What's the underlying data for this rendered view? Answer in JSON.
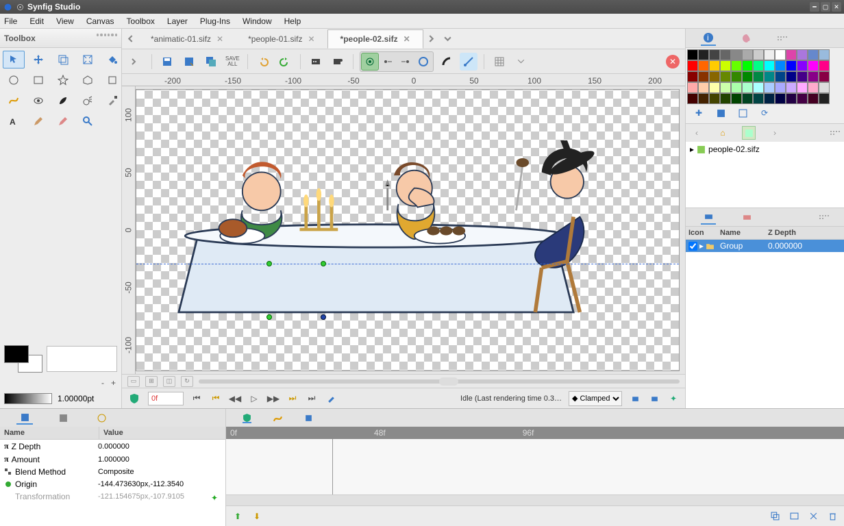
{
  "window": {
    "title": "Synfig Studio"
  },
  "menu": [
    "File",
    "Edit",
    "View",
    "Canvas",
    "Toolbox",
    "Layer",
    "Plug-Ins",
    "Window",
    "Help"
  ],
  "toolbox": {
    "title": "Toolbox",
    "size_minus": "-",
    "size_plus": "+",
    "point_size": "1.00000pt",
    "tools": [
      "arrow",
      "transform",
      "bezier",
      "warp",
      "bucket",
      "circle",
      "rect",
      "star",
      "polygon",
      "crop",
      "curve",
      "eye",
      "brush",
      "spray",
      "picker",
      "text",
      "pencil",
      "eraser",
      "zoom"
    ]
  },
  "tabs": [
    {
      "label": "*animatic-01.sifz",
      "active": false
    },
    {
      "label": "*people-01.sifz",
      "active": false
    },
    {
      "label": "*people-02.sifz",
      "active": true
    }
  ],
  "canvas_toolbar": {
    "save_all_label": "SAVE\nALL"
  },
  "ruler_h": [
    "-200",
    "-150",
    "-100",
    "-50",
    "0",
    "50",
    "100",
    "150",
    "200"
  ],
  "ruler_v": [
    "100",
    "50",
    "0",
    "-50",
    "-100"
  ],
  "playback": {
    "time_value": "0f",
    "status_text": "Idle (Last rendering time 0.3…",
    "interpolation": "Clamped"
  },
  "params_panel": {
    "columns": {
      "name": "Name",
      "value": "Value"
    },
    "rows": [
      {
        "icon": "pi",
        "name": "Z Depth",
        "value": "0.000000"
      },
      {
        "icon": "pi",
        "name": "Amount",
        "value": "1.000000"
      },
      {
        "icon": "blend",
        "name": "Blend Method",
        "value": "Composite"
      },
      {
        "icon": "origin",
        "name": "Origin",
        "value": "-144.473630px,-112.3540"
      },
      {
        "icon": "none",
        "name": "Transformation",
        "value": "-121.154675px,-107.9105"
      }
    ]
  },
  "timeline": {
    "marks": [
      "0f",
      "48f",
      "96f"
    ]
  },
  "palette_colors": [
    [
      "#000",
      "#222",
      "#444",
      "#666",
      "#888",
      "#aaa",
      "#ccc",
      "#eee",
      "#fff",
      "#d4a",
      "#a7d",
      "#68c",
      "#9bd"
    ],
    [
      "#f00",
      "#f60",
      "#fc0",
      "#cf0",
      "#6f0",
      "#0f0",
      "#0f8",
      "#0ff",
      "#08f",
      "#00f",
      "#80f",
      "#f0f",
      "#f08"
    ],
    [
      "#800",
      "#830",
      "#860",
      "#680",
      "#380",
      "#080",
      "#084",
      "#088",
      "#048",
      "#008",
      "#408",
      "#808",
      "#804"
    ],
    [
      "#faa",
      "#fca",
      "#ffa",
      "#cfa",
      "#afa",
      "#afc",
      "#aff",
      "#acf",
      "#aaf",
      "#caf",
      "#faf",
      "#fac",
      "#ddd"
    ],
    [
      "#400",
      "#420",
      "#440",
      "#240",
      "#040",
      "#042",
      "#044",
      "#024",
      "#004",
      "#204",
      "#404",
      "#402",
      "#222"
    ]
  ],
  "navigator": {
    "root_label": "people-02.sifz"
  },
  "layers": {
    "columns": {
      "icon": "Icon",
      "name": "Name",
      "zdepth": "Z Depth"
    },
    "rows": [
      {
        "checked": true,
        "name": "Group",
        "zdepth": "0.000000"
      }
    ]
  }
}
